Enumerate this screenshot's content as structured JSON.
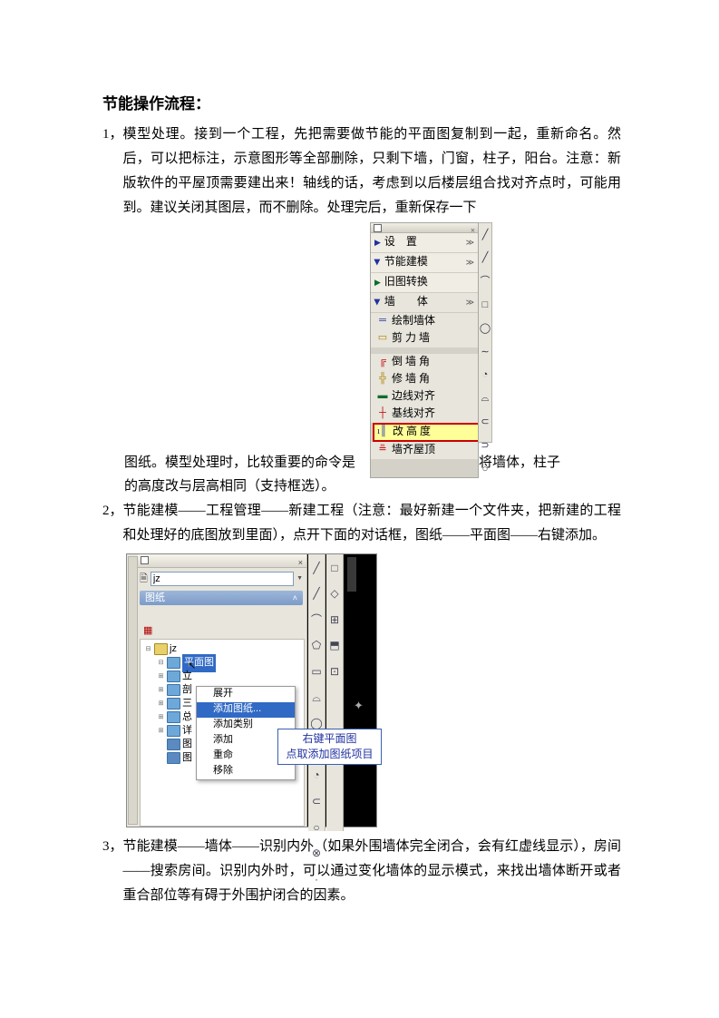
{
  "title": "节能操作流程：",
  "p1_num": "1，",
  "p1_text": "模型处理。接到一个工程，先把需要做节能的平面图复制到一起，重新命名。然后，可以把标注，示意图形等全部删除，只剩下墙，门窗，柱子，阳台。注意：新版软件的平屋顶需要建出来！轴线的话，考虑到以后楼层组合找对齐点时，可能用到。建议关闭其图层，而不删除。处理完后，重新保存一下",
  "p1_tail_a": "图纸。模型处理时，比较重要的命令是",
  "p1_tail_b": "将墙体，柱子",
  "p1_after": "的高度改与层高相同（支持框选）。",
  "p2_num": "2，",
  "p2_text": "节能建模——工程管理——新建工程（注意：最好新建一个文件夹，把新建的工程和处理好的底图放到里面），点开下面的对话框，图纸——平面图——右键添加。",
  "p3_num": "3，",
  "p3_text": "节能建模——墙体——识别内外（如果外围墙体完全闭合，会有红虚线显示），房间——搜索房间。识别内外时，可以通过变化墙体的显示模式，来找出墙体断开或者重合部位等有碍于外围护闭合的因素。",
  "fig1": {
    "menu_settings": "设　置",
    "menu_model": "节能建模",
    "menu_convert": "旧图转换",
    "menu_wall": "墙　　体",
    "sub_draw": "绘制墙体",
    "sub_shear": "剪 力 墙",
    "sub_corner": "倒 墙 角",
    "sub_repair": "修 墙 角",
    "sub_edge": "边线对齐",
    "sub_base": "基线对齐",
    "sub_height": "改 高 度",
    "sub_roof": "墙齐屋顶"
  },
  "fig2": {
    "filename": "jz",
    "panel": "图纸",
    "root": "jz",
    "node_plan": "平面图",
    "node_elev": "立",
    "node_sec": "剖",
    "node_3d": "三",
    "node_gen": "总",
    "node_detail": "详",
    "node_img1": "图",
    "node_img2": "图",
    "ctx_expand": "展开",
    "ctx_add_drawing": "添加图纸...",
    "ctx_add_type": "添加类别",
    "ctx_add": "添加",
    "ctx_rename": "重命",
    "ctx_remove": "移除",
    "callout_l1": "右键平面图",
    "callout_l2": "点取添加图纸项目"
  }
}
